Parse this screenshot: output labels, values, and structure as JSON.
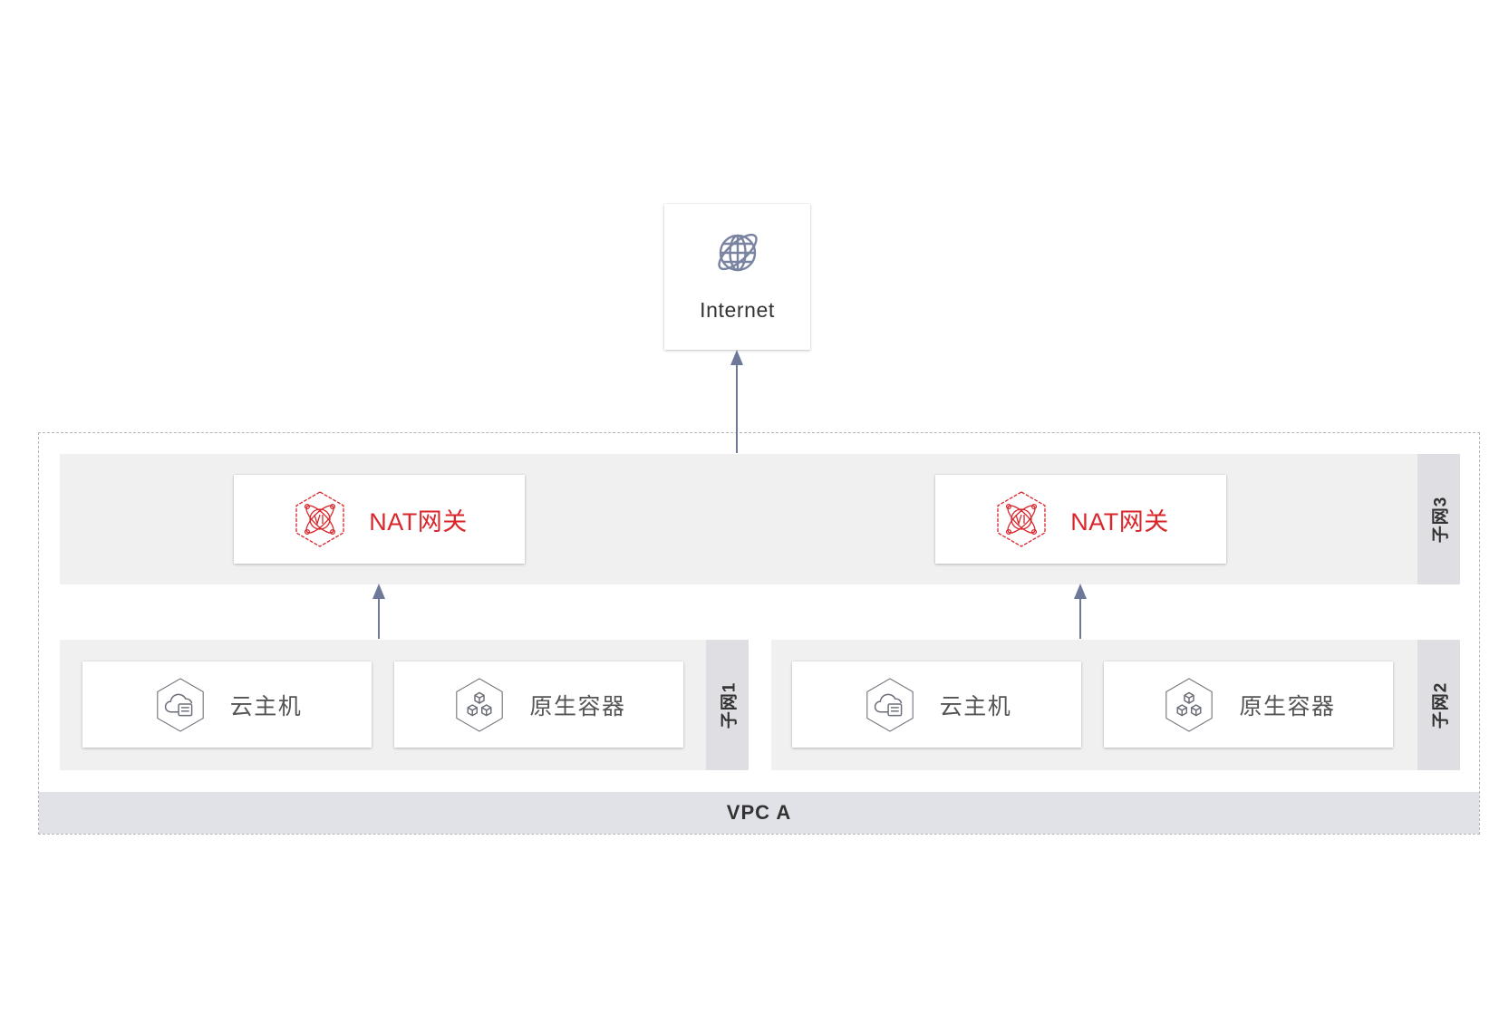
{
  "internet": {
    "label": "Internet",
    "icon": "globe-icon"
  },
  "subnet3": {
    "label": "子网3",
    "gateways": [
      {
        "label": "NAT网关",
        "icon": "nat-gateway-icon"
      },
      {
        "label": "NAT网关",
        "icon": "nat-gateway-icon"
      }
    ]
  },
  "subnet1": {
    "label": "子网1",
    "resources": [
      {
        "label": "云主机",
        "icon": "cloud-host-icon"
      },
      {
        "label": "原生容器",
        "icon": "container-icon"
      }
    ]
  },
  "subnet2": {
    "label": "子网2",
    "resources": [
      {
        "label": "云主机",
        "icon": "cloud-host-icon"
      },
      {
        "label": "原生容器",
        "icon": "container-icon"
      }
    ]
  },
  "vpc": {
    "label": "VPC A"
  },
  "colors": {
    "accent_red": "#d9262b",
    "arrow": "#6e7898",
    "icon_gray": "#6b6e78",
    "globe": "#7a83a0",
    "subnet_bg": "#f0f0f0",
    "label_bar_bg": "#dedee3",
    "vpc_bar_bg": "#e1e2e8",
    "border_dashed": "#b5b5b5"
  }
}
